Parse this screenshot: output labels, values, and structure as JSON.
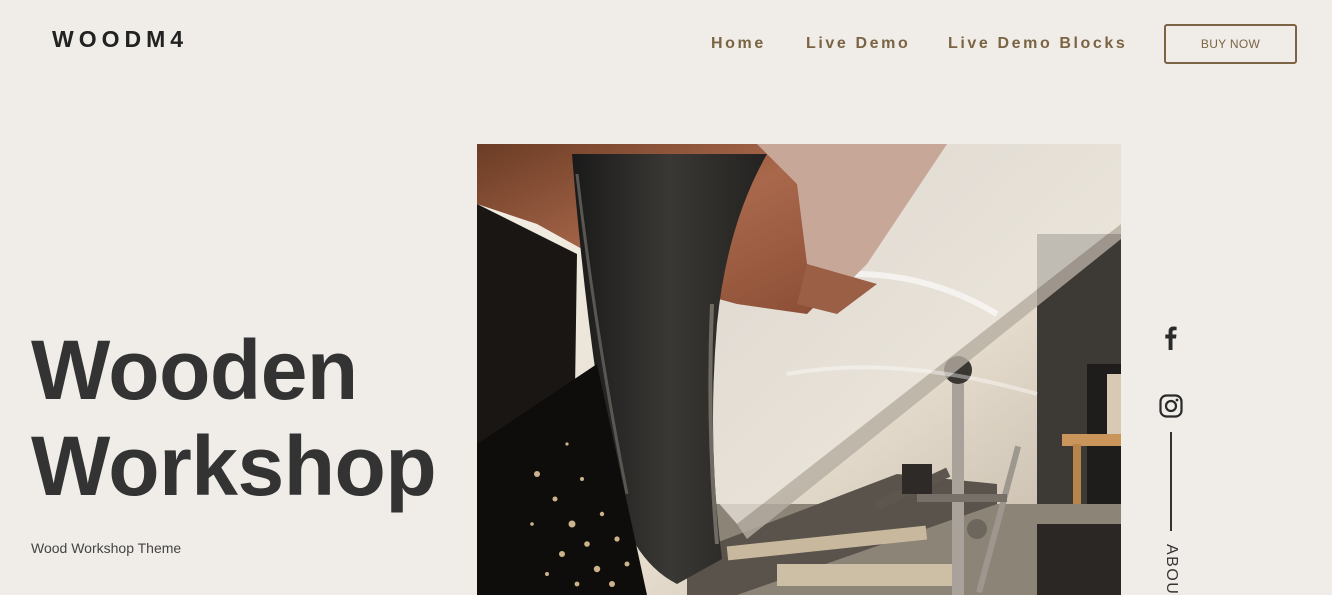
{
  "header": {
    "logo": "WOODM4",
    "nav": [
      "Home",
      "Live Demo",
      "Live Demo Blocks"
    ],
    "cta_label": "BUY NOW"
  },
  "hero": {
    "title_line1": "Wooden",
    "title_line2": "Workshop",
    "subtitle": "Wood Workshop Theme"
  },
  "social": {
    "icons": [
      "facebook-icon",
      "instagram-icon"
    ],
    "vertical_link": "ABOU"
  },
  "colors": {
    "background": "#f0ede8",
    "accent": "#7a6444",
    "text": "#333333"
  }
}
